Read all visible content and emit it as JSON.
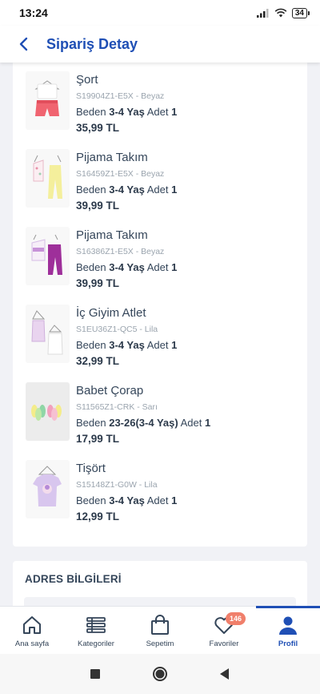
{
  "status": {
    "time": "13:24",
    "battery": "34"
  },
  "header": {
    "title": "Sipariş Detay"
  },
  "items": [
    {
      "name": "Şort",
      "code": "S19904Z1-E5X - Beyaz",
      "size_label": "Beden",
      "size": "3-4 Yaş",
      "qty_label": "Adet",
      "qty": "1",
      "price": "35,99 TL"
    },
    {
      "name": "Pijama Takım",
      "code": "S16459Z1-E5X - Beyaz",
      "size_label": "Beden",
      "size": "3-4 Yaş",
      "qty_label": "Adet",
      "qty": "1",
      "price": "39,99 TL"
    },
    {
      "name": "Pijama Takım",
      "code": "S16386Z1-E5X - Beyaz",
      "size_label": "Beden",
      "size": "3-4 Yaş",
      "qty_label": "Adet",
      "qty": "1",
      "price": "39,99 TL"
    },
    {
      "name": "İç Giyim Atlet",
      "code": "S1EU36Z1-QC5 - Lila",
      "size_label": "Beden",
      "size": "3-4 Yaş",
      "qty_label": "Adet",
      "qty": "1",
      "price": "32,99 TL"
    },
    {
      "name": "Babet Çorap",
      "code": "S11565Z1-CRK - Sarı",
      "size_label": "Beden",
      "size": "23-26(3-4 Yaş)",
      "qty_label": "Adet",
      "qty": "1",
      "price": "17,99 TL"
    },
    {
      "name": "Tişört",
      "code": "S15148Z1-G0W - Lila",
      "size_label": "Beden",
      "size": "3-4 Yaş",
      "qty_label": "Adet",
      "qty": "1",
      "price": "12,99 TL"
    }
  ],
  "address": {
    "title": "ADRES BİLGİLERİ"
  },
  "nav": {
    "home": "Ana sayfa",
    "categories": "Kategoriler",
    "cart": "Sepetim",
    "favorites": "Favoriler",
    "favorites_count": "146",
    "profile": "Profil"
  },
  "colors": {
    "accent": "#1f4fb5",
    "badge": "#f07f6b",
    "background": "#f1f2f6"
  }
}
